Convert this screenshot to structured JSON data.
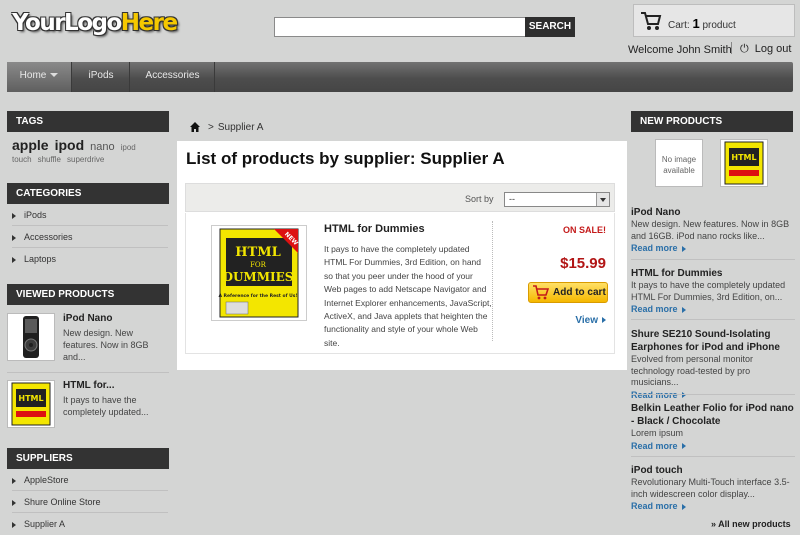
{
  "header": {
    "logo_part1": "YourLogo",
    "logo_part2": "Here",
    "search_button": "SEARCH",
    "search_value": "",
    "cart_label": "Cart:",
    "cart_count": "1",
    "cart_unit": "product",
    "welcome": "Welcome John Smith",
    "logout": "Log out"
  },
  "nav": {
    "items": [
      "Home",
      "iPods",
      "Accessories"
    ]
  },
  "tags": {
    "title": "TAGS",
    "items": [
      "apple",
      "ipod",
      "nano",
      "ipod",
      "touch",
      "shuffle",
      "superdrive"
    ]
  },
  "categories": {
    "title": "CATEGORIES",
    "items": [
      "iPods",
      "Accessories",
      "Laptops"
    ]
  },
  "viewed": {
    "title": "VIEWED PRODUCTS",
    "items": [
      {
        "name": "iPod Nano",
        "desc": "New design. New features. Now in 8GB and..."
      },
      {
        "name": "HTML for...",
        "desc": "It pays to have the completely updated..."
      }
    ]
  },
  "suppliers": {
    "title": "SUPPLIERS",
    "items": [
      "AppleStore",
      "Shure Online Store",
      "Supplier A"
    ]
  },
  "breadcrumb": {
    "current": "Supplier A"
  },
  "main": {
    "title": "List of products by supplier: Supplier A",
    "sort_label": "Sort by",
    "sort_value": "--",
    "product": {
      "name": "HTML for Dummies",
      "desc": "It pays to have the completely updated HTML For Dummies, 3rd Edition, on hand so that you peer under the hood of your Web pages to add Netscape Navigator and Internet Explorer enhancements, JavaScript, ActiveX, and Java applets that heighten the functionality and style of your whole Web site.",
      "badge": "ON SALE!",
      "price": "$15.99",
      "add_to_cart": "Add to cart",
      "view": "View",
      "cover_title_1": "HTML",
      "cover_title_2": "FOR",
      "cover_title_3": "DUMMIES",
      "cover_corner": "NEW",
      "cover_tagline": "A Reference for the Rest of Us!"
    }
  },
  "new_products": {
    "title": "NEW PRODUCTS",
    "no_image": "No image available",
    "items": [
      {
        "name": "iPod Nano",
        "desc": "New design. New features. Now in 8GB and 16GB. iPod nano rocks like...",
        "more": "Read more"
      },
      {
        "name": "HTML for Dummies",
        "desc": "It pays to have the completely updated HTML For Dummies, 3rd Edition, on...",
        "more": "Read more"
      },
      {
        "name": "Shure SE210 Sound-Isolating Earphones for iPod and iPhone",
        "desc": "Evolved from personal monitor technology road-tested by pro musicians...",
        "more": "Read more"
      },
      {
        "name": "Belkin Leather Folio for iPod nano - Black / Chocolate",
        "desc": "Lorem ipsum",
        "more": "Read more"
      },
      {
        "name": "iPod touch",
        "desc": "Revolutionary Multi-Touch interface 3.5-inch widescreen color display...",
        "more": "Read more"
      }
    ],
    "all_link": "» All new products"
  },
  "colors": {
    "background": "#d4d5d4",
    "block_title": "#333333",
    "link": "#2a6fa8",
    "price": "#b21515",
    "cart_button": "#f5b800"
  }
}
